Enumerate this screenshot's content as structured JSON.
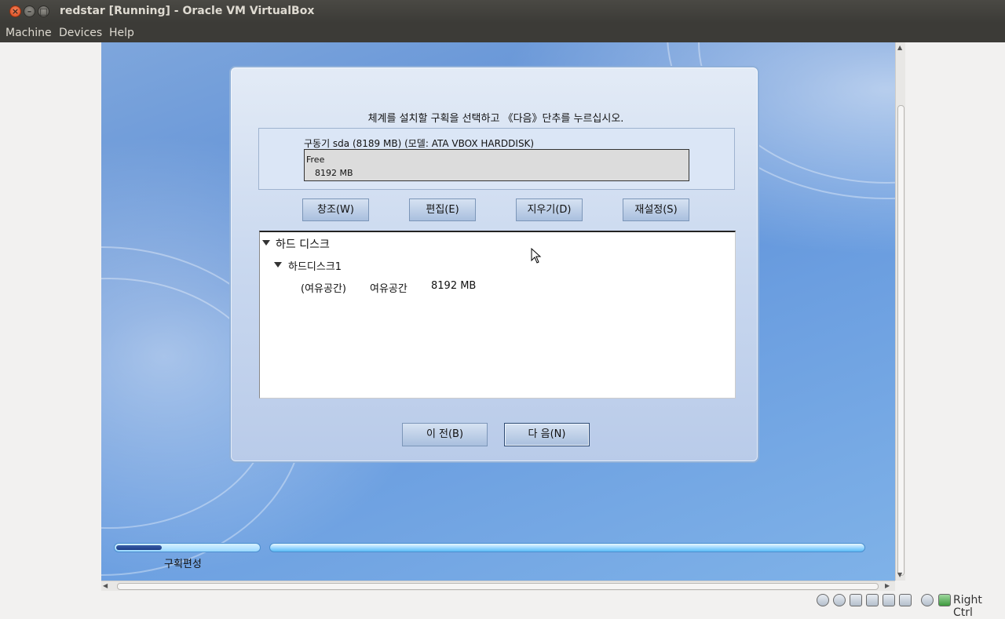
{
  "window": {
    "title": "redstar [Running] - Oracle VM VirtualBox"
  },
  "menubar": {
    "machine": "Machine",
    "devices": "Devices",
    "help": "Help"
  },
  "installer": {
    "instruction": "체계를 설치할 구획을 선택하고 《다음》단추를 누르십시오.",
    "drive_label": "구동기 sda (8189 MB) (모델: ATA VBOX HARDDISK)",
    "drive_bar": {
      "free_label": "Free",
      "size_label": "8192 MB"
    },
    "buttons": {
      "create": "창조(W)",
      "edit": "편집(E)",
      "delete": "지우기(D)",
      "reset": "재설정(S)"
    },
    "tree": {
      "root": "하드 디스크",
      "disk": "하드디스크1",
      "row": {
        "name": "(여유공간)",
        "type": "여유공간",
        "size": "8192 MB"
      }
    },
    "nav": {
      "back": "이 전(B)",
      "next": "다 음(N)"
    }
  },
  "progress": {
    "step_label": "구획편성",
    "step_fraction": 0.32
  },
  "statusbar": {
    "icons": [
      "hard-disk-icon",
      "optical-drive-icon",
      "usb-icon",
      "network-icon",
      "shared-folder-icon",
      "display-icon",
      "mouse-integration-icon",
      "host-key-icon"
    ],
    "host_key": "Right Ctrl"
  }
}
